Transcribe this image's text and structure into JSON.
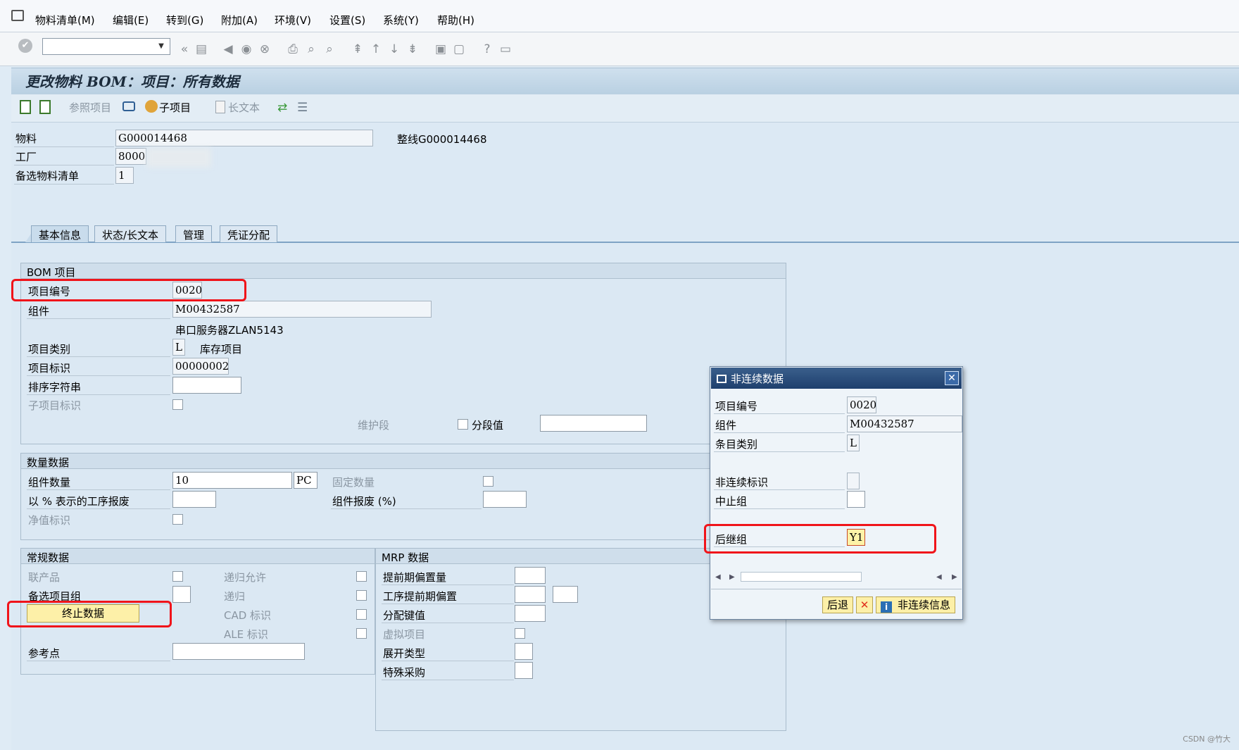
{
  "menu": [
    "物料清单(M)",
    "编辑(E)",
    "转到(G)",
    "附加(A)",
    "环境(V)",
    "设置(S)",
    "系统(Y)",
    "帮助(H)"
  ],
  "page_title": "更改物料 BOM：项目：所有数据",
  "app_toolbar": {
    "ref_item": "参照项目",
    "sub_item": "子项目",
    "long_text": "长文本"
  },
  "header": {
    "material_label": "物料",
    "material_value": "G000014468",
    "material_desc": "整线G000014468",
    "plant_label": "工厂",
    "plant_value": "8000",
    "alt_bom_label": "备选物料清单",
    "alt_bom_value": "1"
  },
  "tabs": [
    "基本信息",
    "状态/长文本",
    "管理",
    "凭证分配"
  ],
  "bom_item": {
    "title": "BOM 项目",
    "item_no_label": "项目编号",
    "item_no": "0020",
    "component_label": "组件",
    "component": "M00432587",
    "component_desc": "串口服务器ZLAN5143",
    "item_cat_label": "项目类别",
    "item_cat": "L",
    "item_cat_desc": "库存项目",
    "item_id_label": "项目标识",
    "item_id": "00000002",
    "sort_label": "排序字符串",
    "sub_item_label": "子项目标识",
    "maint_label": "维护段",
    "segment_label": "分段值"
  },
  "quantity": {
    "title": "数量数据",
    "comp_qty_label": "组件数量",
    "comp_qty": "10",
    "unit": "PC",
    "fixed_label": "固定数量",
    "op_scrap_label": "以 % 表示的工序报废",
    "comp_scrap_label": "组件报废 (%)",
    "net_label": "净值标识"
  },
  "general": {
    "title": "常规数据",
    "coproduct_label": "联产品",
    "alt_group_label": "备选项目组",
    "end_button": "终止数据",
    "recursive_allowed_label": "递归允许",
    "recursive_label": "递归",
    "cad_label": "CAD 标识",
    "ale_label": "ALE 标识",
    "ref_point_label": "参考点"
  },
  "mrp": {
    "title": "MRP 数据",
    "lead_offset_label": "提前期偏置量",
    "op_lead_label": "工序提前期偏置",
    "dist_key_label": "分配键值",
    "phantom_label": "虚拟项目",
    "explosion_label": "展开类型",
    "special_proc_label": "特殊采购"
  },
  "dialog": {
    "title": "非连续数据",
    "item_no_label": "项目编号",
    "item_no": "0020",
    "component_label": "组件",
    "component": "M00432587",
    "cat_label": "条目类别",
    "cat": "L",
    "disc_label": "非连续标识",
    "stop_label": "中止组",
    "follow_label": "后继组",
    "follow": "Y1",
    "back_btn": "后退",
    "info_btn": "非连续信息"
  },
  "watermark": "CSDN @竹大"
}
